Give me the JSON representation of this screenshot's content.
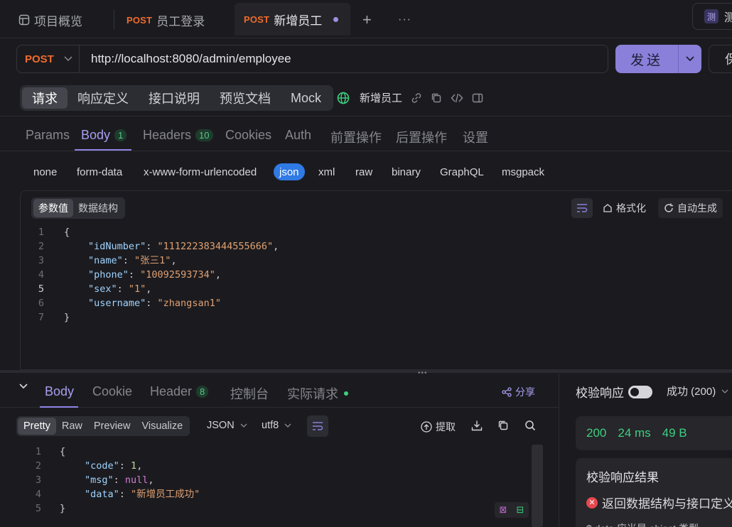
{
  "tabs": [
    {
      "label": "项目概览"
    },
    {
      "method": "POST",
      "label": "员工登录"
    },
    {
      "method": "POST",
      "label": "新增员工"
    }
  ],
  "tab_add": "+",
  "tab_more": "···",
  "top_right_label": "测",
  "top_right_extra": "测",
  "request": {
    "method": "POST",
    "url": "http://localhost:8080/admin/employee",
    "send_label": "发送",
    "save_label": "保"
  },
  "segments": [
    "请求",
    "响应定义",
    "接口说明",
    "预览文档",
    "Mock"
  ],
  "doc_name": "新增员工",
  "param_tabs": [
    {
      "label": "Params"
    },
    {
      "label": "Body",
      "badge": "1"
    },
    {
      "label": "Headers",
      "badge": "10"
    },
    {
      "label": "Cookies"
    },
    {
      "label": "Auth"
    },
    {
      "label": "前置操作"
    },
    {
      "label": "后置操作"
    },
    {
      "label": "设置"
    }
  ],
  "body_types": [
    "none",
    "form-data",
    "x-www-form-urlencoded",
    "json",
    "xml",
    "raw",
    "binary",
    "GraphQL",
    "msgpack"
  ],
  "editor": {
    "tabs": [
      "参数值",
      "数据结构"
    ],
    "format_label": "格式化",
    "autogen_label": "自动生成",
    "line_numbers": [
      "1",
      "2",
      "3",
      "4",
      "5",
      "6",
      "7"
    ],
    "fields": [
      {
        "key": "\"idNumber\"",
        "value": "\"111222383444555666\""
      },
      {
        "key": "\"name\"",
        "value": "\"张三1\""
      },
      {
        "key": "\"phone\"",
        "value": "\"10092593734\""
      },
      {
        "key": "\"sex\"",
        "value": "\"1\""
      },
      {
        "key": "\"username\"",
        "value": "\"zhangsan1\""
      }
    ],
    "open_brace": "{",
    "close_brace": "}"
  },
  "response": {
    "tabs": [
      {
        "label": "Body"
      },
      {
        "label": "Cookie"
      },
      {
        "label": "Header",
        "badge": "8"
      },
      {
        "label": "控制台"
      },
      {
        "label": "实际请求"
      }
    ],
    "share_label": "分享",
    "view_tabs": [
      "Pretty",
      "Raw",
      "Preview",
      "Visualize"
    ],
    "format": "JSON",
    "encoding": "utf8",
    "extract_label": "提取",
    "line_numbers": [
      "1",
      "2",
      "3",
      "4",
      "5"
    ],
    "fields": [
      {
        "key": "\"code\"",
        "value": "1",
        "type": "num"
      },
      {
        "key": "\"msg\"",
        "value": "null",
        "type": "nul"
      },
      {
        "key": "\"data\"",
        "value": "\"新增员工成功\"",
        "type": "str"
      }
    ],
    "open_brace": "{",
    "close_brace": "}"
  },
  "validate": {
    "label": "校验响应",
    "status": "成功 (200)",
    "code": "200",
    "time": "24 ms",
    "size": "49 B",
    "result_title": "校验响应结果",
    "error_text": "返回数据结构与接口定义",
    "detail_text": "$.data 应当是 object 类型"
  },
  "colors": {
    "accent": "#8a7fd9",
    "method": "#f06b2c",
    "success": "#3ecf7e",
    "json_active": "#2f7ae5"
  }
}
